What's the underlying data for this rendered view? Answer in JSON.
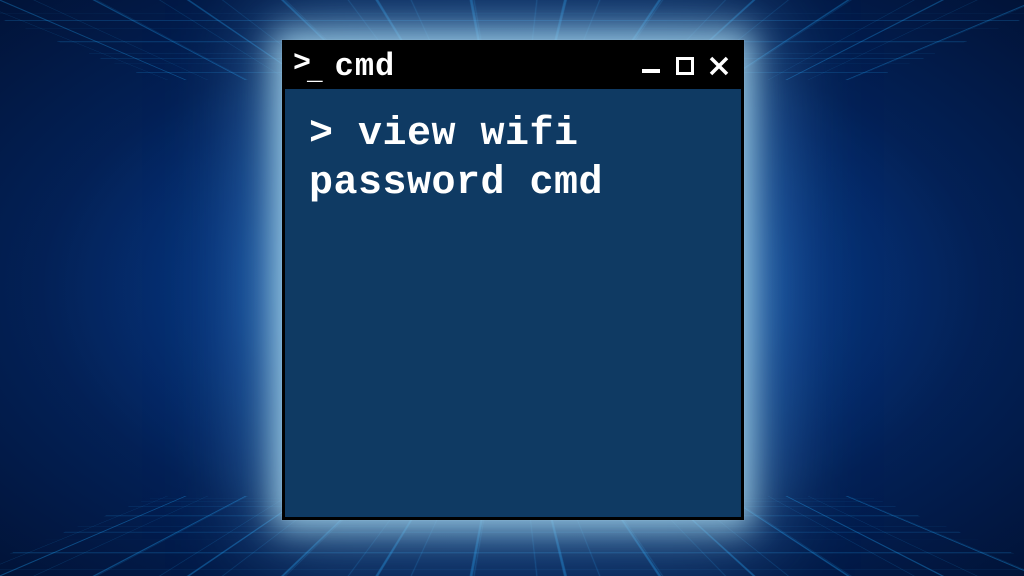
{
  "window": {
    "title": "cmd",
    "controls": {
      "minimize": "minimize",
      "maximize": "maximize",
      "close": "close"
    }
  },
  "terminal": {
    "prompt": "> ",
    "command": "view wifi password cmd"
  },
  "colors": {
    "titlebar_bg": "#000000",
    "titlebar_fg": "#ffffff",
    "body_bg": "#0f3a63",
    "body_fg": "#ffffff",
    "glow": "#7fd4ff"
  }
}
